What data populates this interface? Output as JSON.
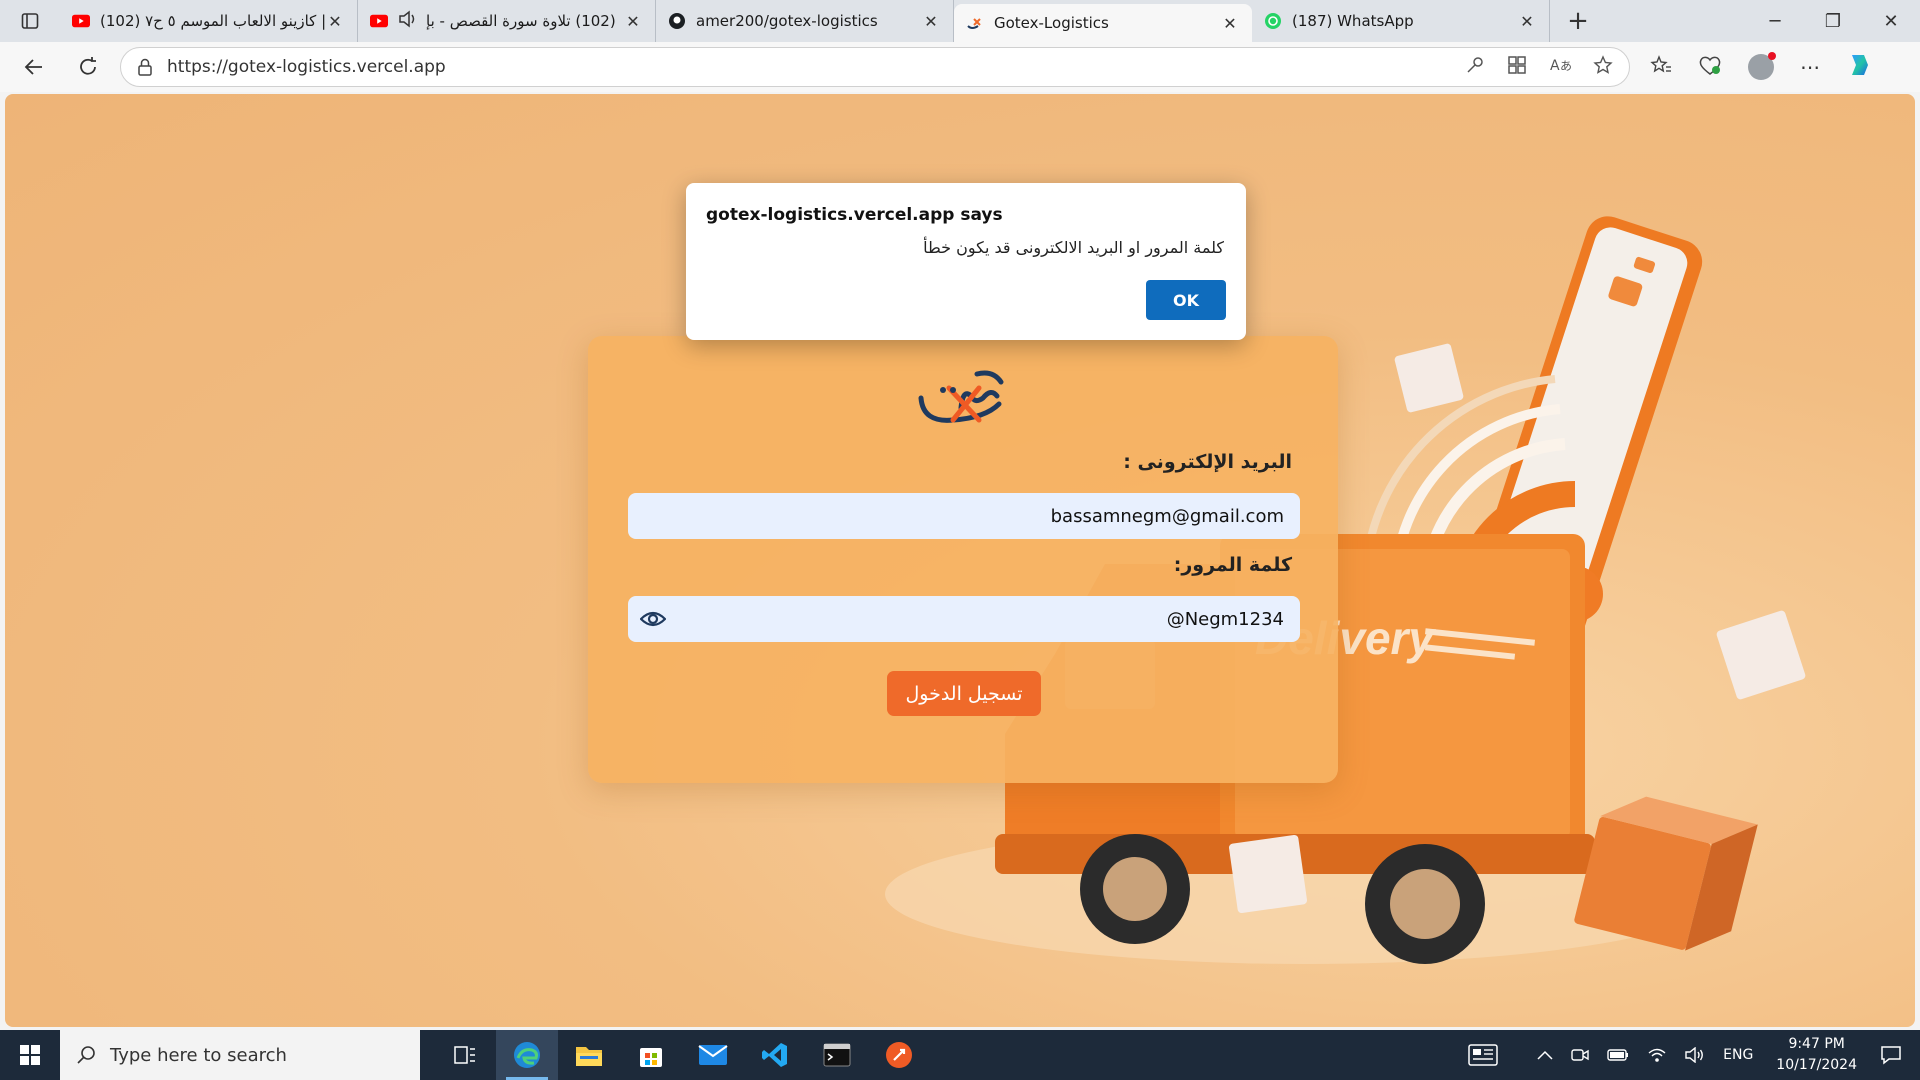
{
  "browser": {
    "tabs": [
      {
        "title": "(102) كازينو الالعاب الموسم ٥ ح٧ |",
        "favicon": "youtube-icon",
        "active": false,
        "audio": false
      },
      {
        "title": "(102) تلاوة سورة القصص - بإ",
        "favicon": "youtube-icon",
        "active": false,
        "audio": true
      },
      {
        "title": "amer200/gotex-logistics",
        "favicon": "github-icon",
        "active": false,
        "audio": false
      },
      {
        "title": "Gotex-Logistics",
        "favicon": "gotex-icon",
        "active": true,
        "audio": false
      },
      {
        "title": "(187) WhatsApp",
        "favicon": "whatsapp-icon",
        "active": false,
        "audio": false
      }
    ],
    "url": "https://gotex-logistics.vercel.app"
  },
  "dialog": {
    "heading": "gotex-logistics.vercel.app says",
    "message": "كلمة المرور او البريد الالكترونى قد يكون خطأ",
    "ok_label": "OK"
  },
  "login": {
    "email_label": "البريد الإلكترونى :",
    "email_value": "bassamnegm@gmail.com",
    "password_label": "كلمة المرور:",
    "password_value": "@Negm1234",
    "submit_label": "تسجيل الدخول"
  },
  "illustration": {
    "truck_text": "Delivery"
  },
  "taskbar": {
    "search_placeholder": "Type here to search",
    "language": "ENG",
    "time": "9:47 PM",
    "date": "10/17/2024"
  },
  "colors": {
    "page_bg": "#f2bd82",
    "card_bg": "#f6b262",
    "accent_button": "#ef6a2a",
    "dialog_ok": "#0f6cbd",
    "taskbar_bg": "#1d2a3a"
  }
}
